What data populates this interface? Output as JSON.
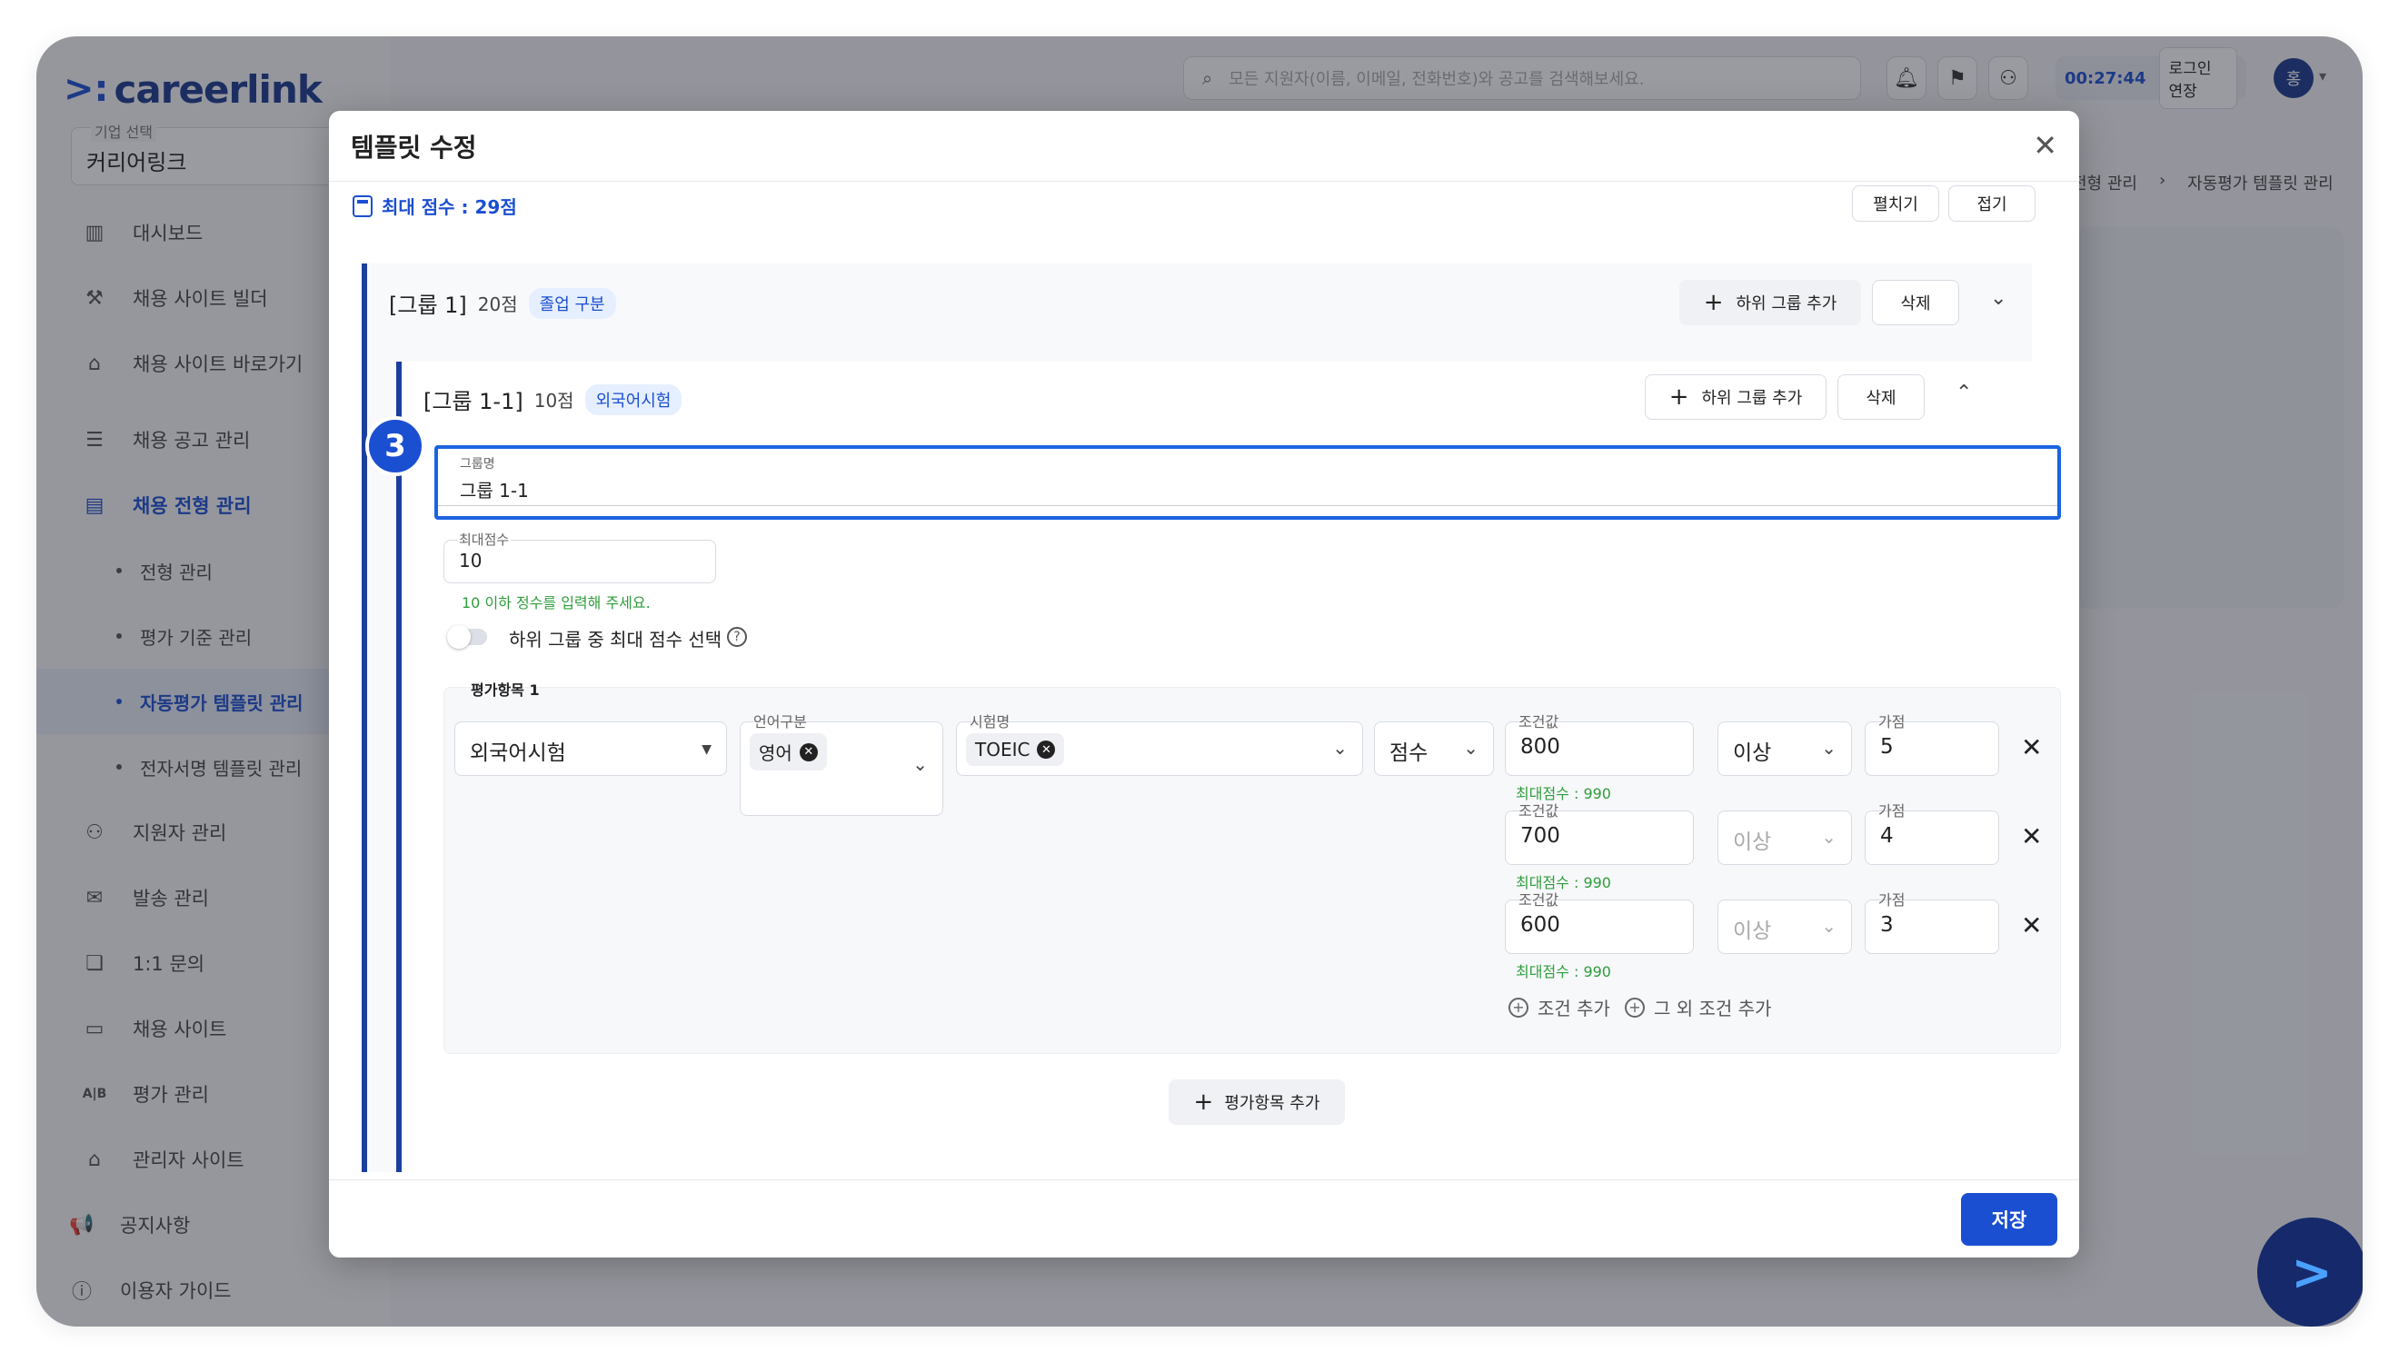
{
  "app": {
    "logo_text": "careerlink"
  },
  "sidebar": {
    "company_label": "기업 선택",
    "company_value": "커리어링크",
    "items": [
      {
        "label": "대시보드",
        "icon": "chart-icon"
      },
      {
        "label": "채용 사이트 빌더",
        "icon": "wrench-icon"
      },
      {
        "label": "채용 사이트 바로가기",
        "icon": "home-icon"
      },
      {
        "label": "채용 공고 관리",
        "icon": "list-icon"
      },
      {
        "label": "채용 전형 관리",
        "icon": "clipboard-icon"
      },
      {
        "label": "지원자 관리",
        "icon": "users-icon"
      },
      {
        "label": "발송 관리",
        "icon": "mail-icon"
      },
      {
        "label": "1:1 문의",
        "icon": "chat-icon"
      },
      {
        "label": "채용 사이트",
        "icon": "window-icon"
      },
      {
        "label": "평가 관리",
        "icon": "ab-icon"
      },
      {
        "label": "관리자 사이트",
        "icon": "home-gear-icon"
      },
      {
        "label": "공지사항",
        "icon": "megaphone-icon"
      },
      {
        "label": "이용자 가이드",
        "icon": "help-icon"
      }
    ],
    "sub_items": [
      "전형 관리",
      "평가 기준 관리",
      "자동평가 템플릿 관리",
      "전자서명 템플릿 관리"
    ]
  },
  "topbar": {
    "search_placeholder": "모든 지원자(이름, 이메일, 전화번호)와 공고를 검색해보세요.",
    "timer": "00:27:44",
    "extend_label": "로그인 연장",
    "avatar_initial": "홍"
  },
  "breadcrumb": [
    "전형 관리",
    "자동평가 템플릿 관리"
  ],
  "modal": {
    "title": "템플릿 수정",
    "max_score": "최대 점수 : 29점",
    "expand_label": "펼치기",
    "collapse_label": "접기",
    "group1": {
      "title": "[그룹 1]",
      "score": "20점",
      "tag": "졸업 구분"
    },
    "group11": {
      "title": "[그룹 1-1]",
      "score": "10점",
      "tag": "외국어시험"
    },
    "add_sub_label": "하위 그룹 추가",
    "delete_label": "삭제",
    "step_number": "3",
    "group_name_label": "그룹명",
    "group_name_value": "그룹 1-1",
    "max_score_label": "최대점수",
    "max_score_value": "10",
    "max_score_hint": "10 이하 정수를 입력해 주세요.",
    "toggle_label": "하위 그룹 중 최대 점수 선택",
    "eval_title": "평가항목 1",
    "exam_type": "외국어시험",
    "language_label": "언어구분",
    "language_chip": "영어",
    "exam_name_label": "시험명",
    "exam_chip": "TOEIC",
    "measure": "점수",
    "cond_label": "조건값",
    "add_label": "가점",
    "conditions": [
      {
        "value": "800",
        "op": "이상",
        "points": "5",
        "hint": "최대점수 : 990"
      },
      {
        "value": "700",
        "op": "이상",
        "points": "4",
        "hint": "최대점수 : 990"
      },
      {
        "value": "600",
        "op": "이상",
        "points": "3",
        "hint": "최대점수 : 990"
      }
    ],
    "add_condition": "조건 추가",
    "add_other_condition": "그 외 조건 추가",
    "add_eval_item": "평가항목 추가",
    "save_label": "저장"
  },
  "colors": {
    "accent": "#1b4fd1",
    "navy": "#1b3f9e",
    "hint_green": "#2e9d3b"
  }
}
